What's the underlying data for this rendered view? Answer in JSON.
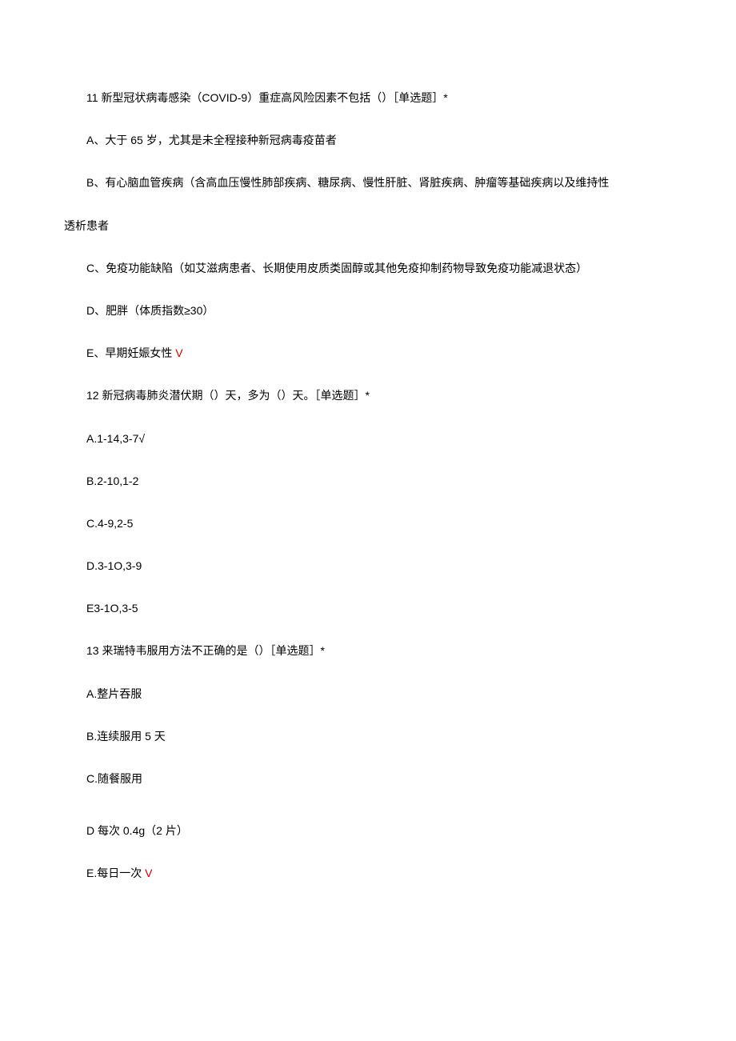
{
  "questions": [
    {
      "number": "11",
      "stem": "新型冠状病毒感染（COVID-9）重症高风险因素不包括（）［单选题］*",
      "options": [
        {
          "label": "A、",
          "text": "大于 65 岁，尤其是未全程接种新冠病毒疫苗者",
          "correct": false
        },
        {
          "label": "B、",
          "text": "有心脑血管疾病（含高血压慢性肺部疾病、糖尿病、慢性肝脏、肾脏疾病、肿瘤等基础疾病以及维持性",
          "continuation": "透析患者",
          "correct": false
        },
        {
          "label": "C、",
          "text": "免疫功能缺陷（如艾滋病患者、长期使用皮质类固醇或其他免疫抑制药物导致免疫功能减退状态）",
          "correct": false
        },
        {
          "label": "D、",
          "text": "肥胖（体质指数≥30）",
          "correct": false
        },
        {
          "label": "E、",
          "text": "早期妊娠女性",
          "correct": true,
          "mark": " V"
        }
      ]
    },
    {
      "number": "12",
      "stem": "新冠病毒肺炎潜伏期（）天，多为（）天。［单选题］*",
      "options": [
        {
          "label": "A.",
          "text": "1-14,3-7",
          "correct": true,
          "mark": "√"
        },
        {
          "label": "B.",
          "text": "2-10,1-2",
          "correct": false
        },
        {
          "label": "C.",
          "text": "4-9,2-5",
          "correct": false
        },
        {
          "label": "D.",
          "text": "3-1O,3-9",
          "correct": false
        },
        {
          "label": "E",
          "text": "3-1O,3-5",
          "correct": false
        }
      ]
    },
    {
      "number": "13",
      "stem": "来瑞特韦服用方法不正确的是（）［单选题］*",
      "options": [
        {
          "label": "A.",
          "text": "整片吞服",
          "correct": false
        },
        {
          "label": "B.",
          "text": "连续服用 5 天",
          "correct": false
        },
        {
          "label": "C.",
          "text": "随餐服用",
          "correct": false
        },
        {
          "label": "D ",
          "text": "每次 0.4g（2 片）",
          "correct": false,
          "gapBefore": true
        },
        {
          "label": "E.",
          "text": "每日一次",
          "correct": true,
          "mark": " V"
        }
      ]
    }
  ]
}
